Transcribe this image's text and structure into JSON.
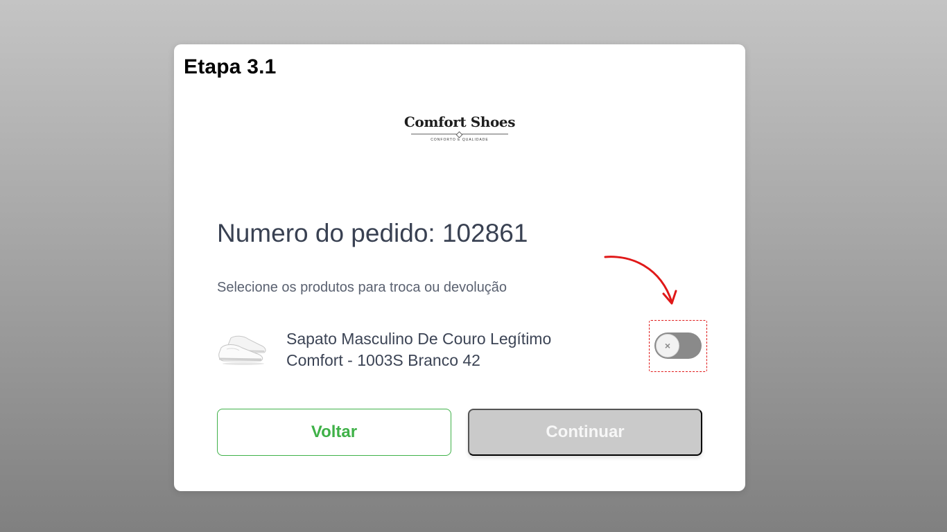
{
  "step_label": "Etapa 3.1",
  "logo": {
    "name": "Comfort Shoes",
    "tagline": "CONFORTO E QUALIDADE"
  },
  "order": {
    "title": "Numero do pedido: 102861"
  },
  "instruction": "Selecione os produtos para troca ou devolução",
  "product": {
    "name_line1": "Sapato Masculino De Couro Legítimo",
    "name_line2": "Comfort - 1003S Branco 42",
    "image_icon": "white-shoes-icon",
    "toggle_selected": false,
    "toggle_symbol": "×"
  },
  "buttons": {
    "back_label": "Voltar",
    "continue_label": "Continuar",
    "continue_enabled": false
  },
  "colors": {
    "accent_green": "#3fb148",
    "annotation_red": "#e01818",
    "disabled_gray": "#cacaca",
    "toggle_off": "#8a8a8a"
  }
}
